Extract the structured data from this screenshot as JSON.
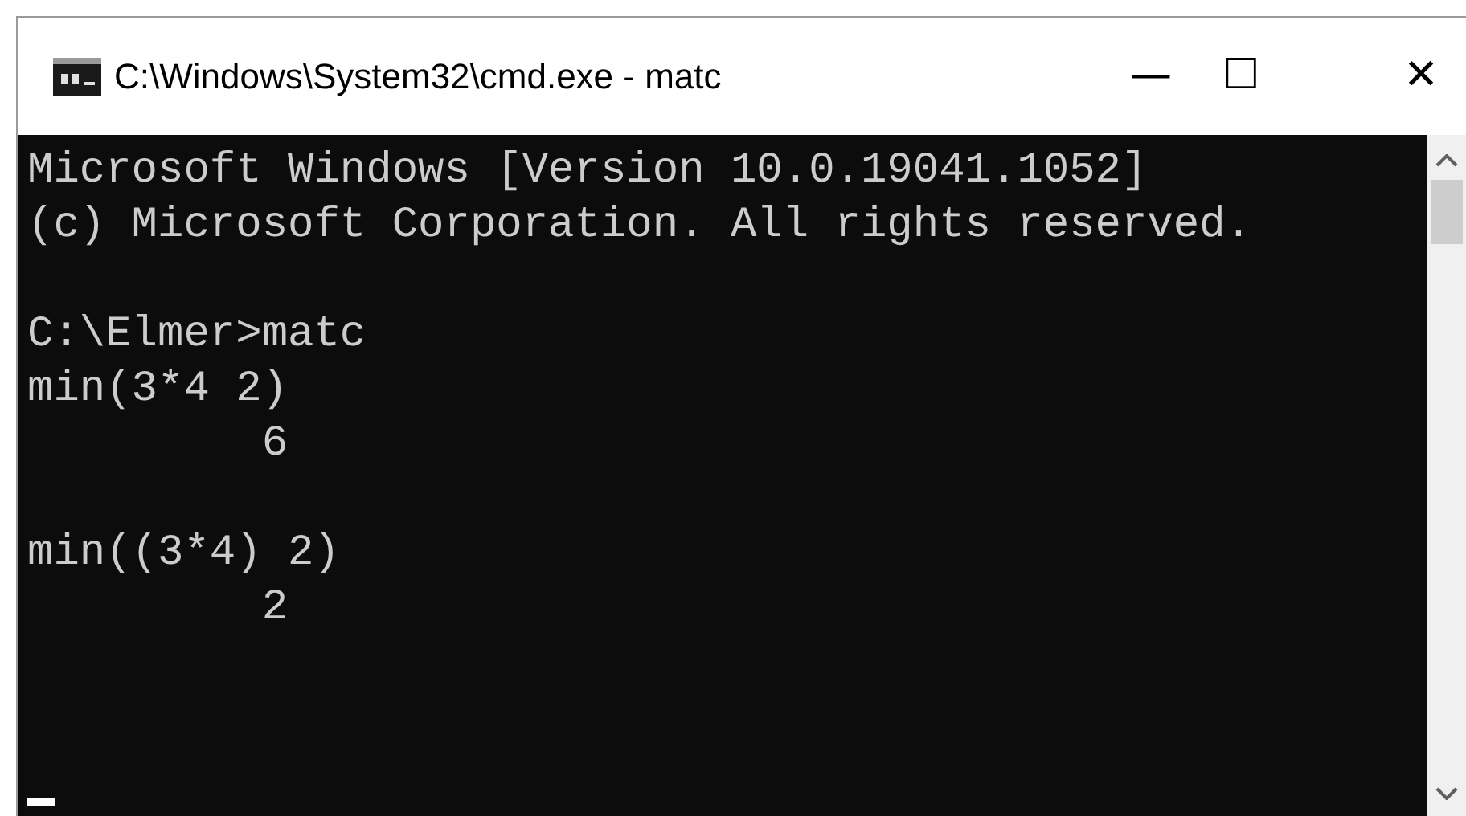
{
  "window": {
    "title": "C:\\Windows\\System32\\cmd.exe - matc",
    "controls": [
      "—",
      "☐",
      "✕"
    ]
  },
  "console": {
    "blocks": [
      [
        "Microsoft Windows [Version 10.0.19041.1052]",
        "(c) Microsoft Corporation. All rights reserved."
      ],
      [
        "C:\\Elmer>matc",
        "min(3*4 2)",
        "         6"
      ],
      [
        "min((3*4) 2)",
        "         2"
      ]
    ]
  }
}
